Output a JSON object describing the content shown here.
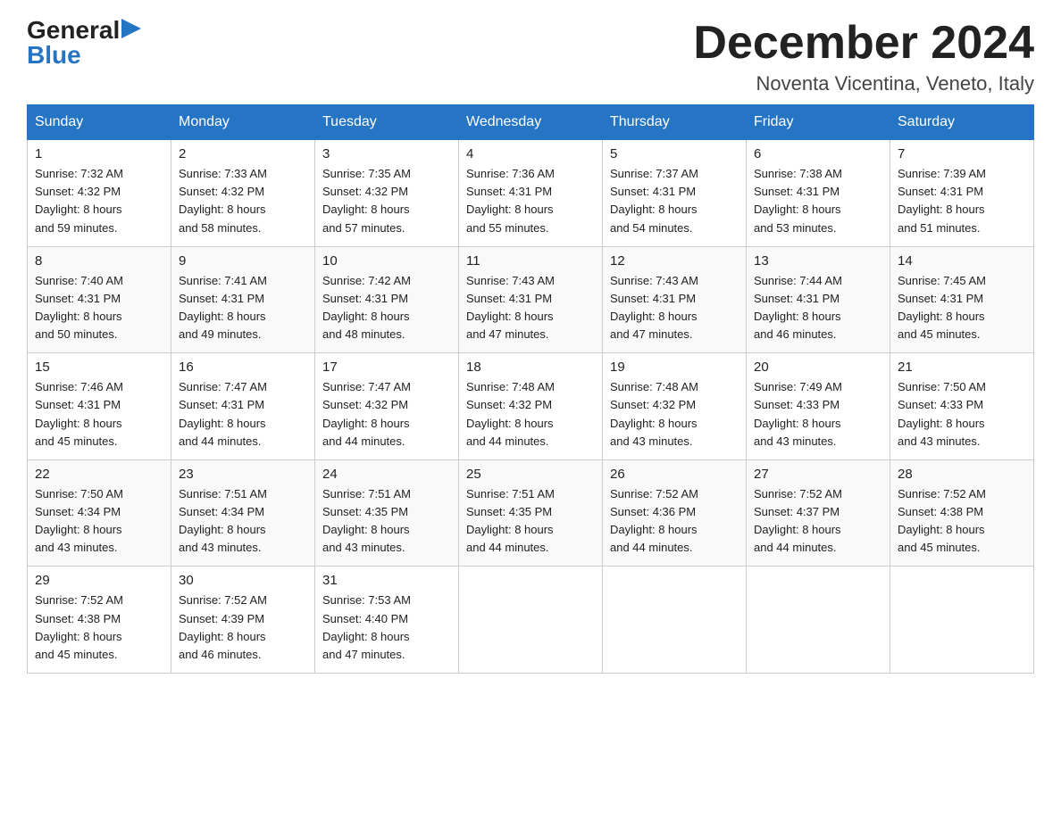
{
  "logo": {
    "general": "General",
    "blue": "Blue"
  },
  "header": {
    "month_year": "December 2024",
    "location": "Noventa Vicentina, Veneto, Italy"
  },
  "days_of_week": [
    "Sunday",
    "Monday",
    "Tuesday",
    "Wednesday",
    "Thursday",
    "Friday",
    "Saturday"
  ],
  "weeks": [
    [
      {
        "day": "1",
        "sunrise": "7:32 AM",
        "sunset": "4:32 PM",
        "daylight": "8 hours and 59 minutes."
      },
      {
        "day": "2",
        "sunrise": "7:33 AM",
        "sunset": "4:32 PM",
        "daylight": "8 hours and 58 minutes."
      },
      {
        "day": "3",
        "sunrise": "7:35 AM",
        "sunset": "4:32 PM",
        "daylight": "8 hours and 57 minutes."
      },
      {
        "day": "4",
        "sunrise": "7:36 AM",
        "sunset": "4:31 PM",
        "daylight": "8 hours and 55 minutes."
      },
      {
        "day": "5",
        "sunrise": "7:37 AM",
        "sunset": "4:31 PM",
        "daylight": "8 hours and 54 minutes."
      },
      {
        "day": "6",
        "sunrise": "7:38 AM",
        "sunset": "4:31 PM",
        "daylight": "8 hours and 53 minutes."
      },
      {
        "day": "7",
        "sunrise": "7:39 AM",
        "sunset": "4:31 PM",
        "daylight": "8 hours and 51 minutes."
      }
    ],
    [
      {
        "day": "8",
        "sunrise": "7:40 AM",
        "sunset": "4:31 PM",
        "daylight": "8 hours and 50 minutes."
      },
      {
        "day": "9",
        "sunrise": "7:41 AM",
        "sunset": "4:31 PM",
        "daylight": "8 hours and 49 minutes."
      },
      {
        "day": "10",
        "sunrise": "7:42 AM",
        "sunset": "4:31 PM",
        "daylight": "8 hours and 48 minutes."
      },
      {
        "day": "11",
        "sunrise": "7:43 AM",
        "sunset": "4:31 PM",
        "daylight": "8 hours and 47 minutes."
      },
      {
        "day": "12",
        "sunrise": "7:43 AM",
        "sunset": "4:31 PM",
        "daylight": "8 hours and 47 minutes."
      },
      {
        "day": "13",
        "sunrise": "7:44 AM",
        "sunset": "4:31 PM",
        "daylight": "8 hours and 46 minutes."
      },
      {
        "day": "14",
        "sunrise": "7:45 AM",
        "sunset": "4:31 PM",
        "daylight": "8 hours and 45 minutes."
      }
    ],
    [
      {
        "day": "15",
        "sunrise": "7:46 AM",
        "sunset": "4:31 PM",
        "daylight": "8 hours and 45 minutes."
      },
      {
        "day": "16",
        "sunrise": "7:47 AM",
        "sunset": "4:31 PM",
        "daylight": "8 hours and 44 minutes."
      },
      {
        "day": "17",
        "sunrise": "7:47 AM",
        "sunset": "4:32 PM",
        "daylight": "8 hours and 44 minutes."
      },
      {
        "day": "18",
        "sunrise": "7:48 AM",
        "sunset": "4:32 PM",
        "daylight": "8 hours and 44 minutes."
      },
      {
        "day": "19",
        "sunrise": "7:48 AM",
        "sunset": "4:32 PM",
        "daylight": "8 hours and 43 minutes."
      },
      {
        "day": "20",
        "sunrise": "7:49 AM",
        "sunset": "4:33 PM",
        "daylight": "8 hours and 43 minutes."
      },
      {
        "day": "21",
        "sunrise": "7:50 AM",
        "sunset": "4:33 PM",
        "daylight": "8 hours and 43 minutes."
      }
    ],
    [
      {
        "day": "22",
        "sunrise": "7:50 AM",
        "sunset": "4:34 PM",
        "daylight": "8 hours and 43 minutes."
      },
      {
        "day": "23",
        "sunrise": "7:51 AM",
        "sunset": "4:34 PM",
        "daylight": "8 hours and 43 minutes."
      },
      {
        "day": "24",
        "sunrise": "7:51 AM",
        "sunset": "4:35 PM",
        "daylight": "8 hours and 43 minutes."
      },
      {
        "day": "25",
        "sunrise": "7:51 AM",
        "sunset": "4:35 PM",
        "daylight": "8 hours and 44 minutes."
      },
      {
        "day": "26",
        "sunrise": "7:52 AM",
        "sunset": "4:36 PM",
        "daylight": "8 hours and 44 minutes."
      },
      {
        "day": "27",
        "sunrise": "7:52 AM",
        "sunset": "4:37 PM",
        "daylight": "8 hours and 44 minutes."
      },
      {
        "day": "28",
        "sunrise": "7:52 AM",
        "sunset": "4:38 PM",
        "daylight": "8 hours and 45 minutes."
      }
    ],
    [
      {
        "day": "29",
        "sunrise": "7:52 AM",
        "sunset": "4:38 PM",
        "daylight": "8 hours and 45 minutes."
      },
      {
        "day": "30",
        "sunrise": "7:52 AM",
        "sunset": "4:39 PM",
        "daylight": "8 hours and 46 minutes."
      },
      {
        "day": "31",
        "sunrise": "7:53 AM",
        "sunset": "4:40 PM",
        "daylight": "8 hours and 47 minutes."
      },
      null,
      null,
      null,
      null
    ]
  ],
  "labels": {
    "sunrise": "Sunrise:",
    "sunset": "Sunset:",
    "daylight": "Daylight:"
  }
}
